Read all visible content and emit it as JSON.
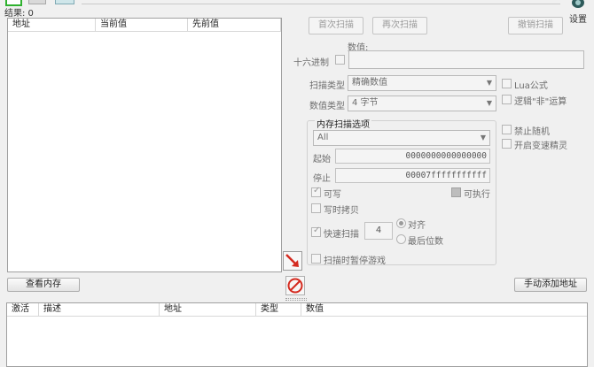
{
  "result_label": "结果: 0",
  "settings_label": "设置",
  "results_table": {
    "columns": [
      "地址",
      "当前值",
      "先前值"
    ]
  },
  "scan_buttons": {
    "first": "首次扫描",
    "next": "再次扫描",
    "undo": "撤销扫描"
  },
  "value": {
    "label": "数值:",
    "hex_label": "十六进制",
    "input": ""
  },
  "scan_type": {
    "label": "扫描类型",
    "selected": "精确数值"
  },
  "value_type": {
    "label": "数值类型",
    "selected": "4 字节"
  },
  "right_options": {
    "lua": "Lua公式",
    "not_op": "逻辑\"非\"运算",
    "no_random": "禁止随机",
    "speedhack": "开启变速精灵"
  },
  "memory_options": {
    "title": "内存扫描选项",
    "region": "All",
    "start_label": "起始",
    "start_value": "0000000000000000",
    "stop_label": "停止",
    "stop_value": "00007fffffffffff",
    "writable": "可写",
    "executable": "可执行",
    "copy_on_write": "写时拷贝",
    "fast_scan": "快速扫描",
    "fast_scan_value": "4",
    "align": "对齐",
    "last_digits": "最后位数",
    "pause_game": "扫描时暂停游戏"
  },
  "view_memory": "查看内存",
  "add_address": "手动添加地址",
  "address_list": {
    "columns": [
      "激活",
      "描述",
      "地址",
      "类型",
      "数值"
    ]
  },
  "colors": {
    "accent_green": "#2fb12f",
    "arrow_red": "#d42a1f"
  }
}
